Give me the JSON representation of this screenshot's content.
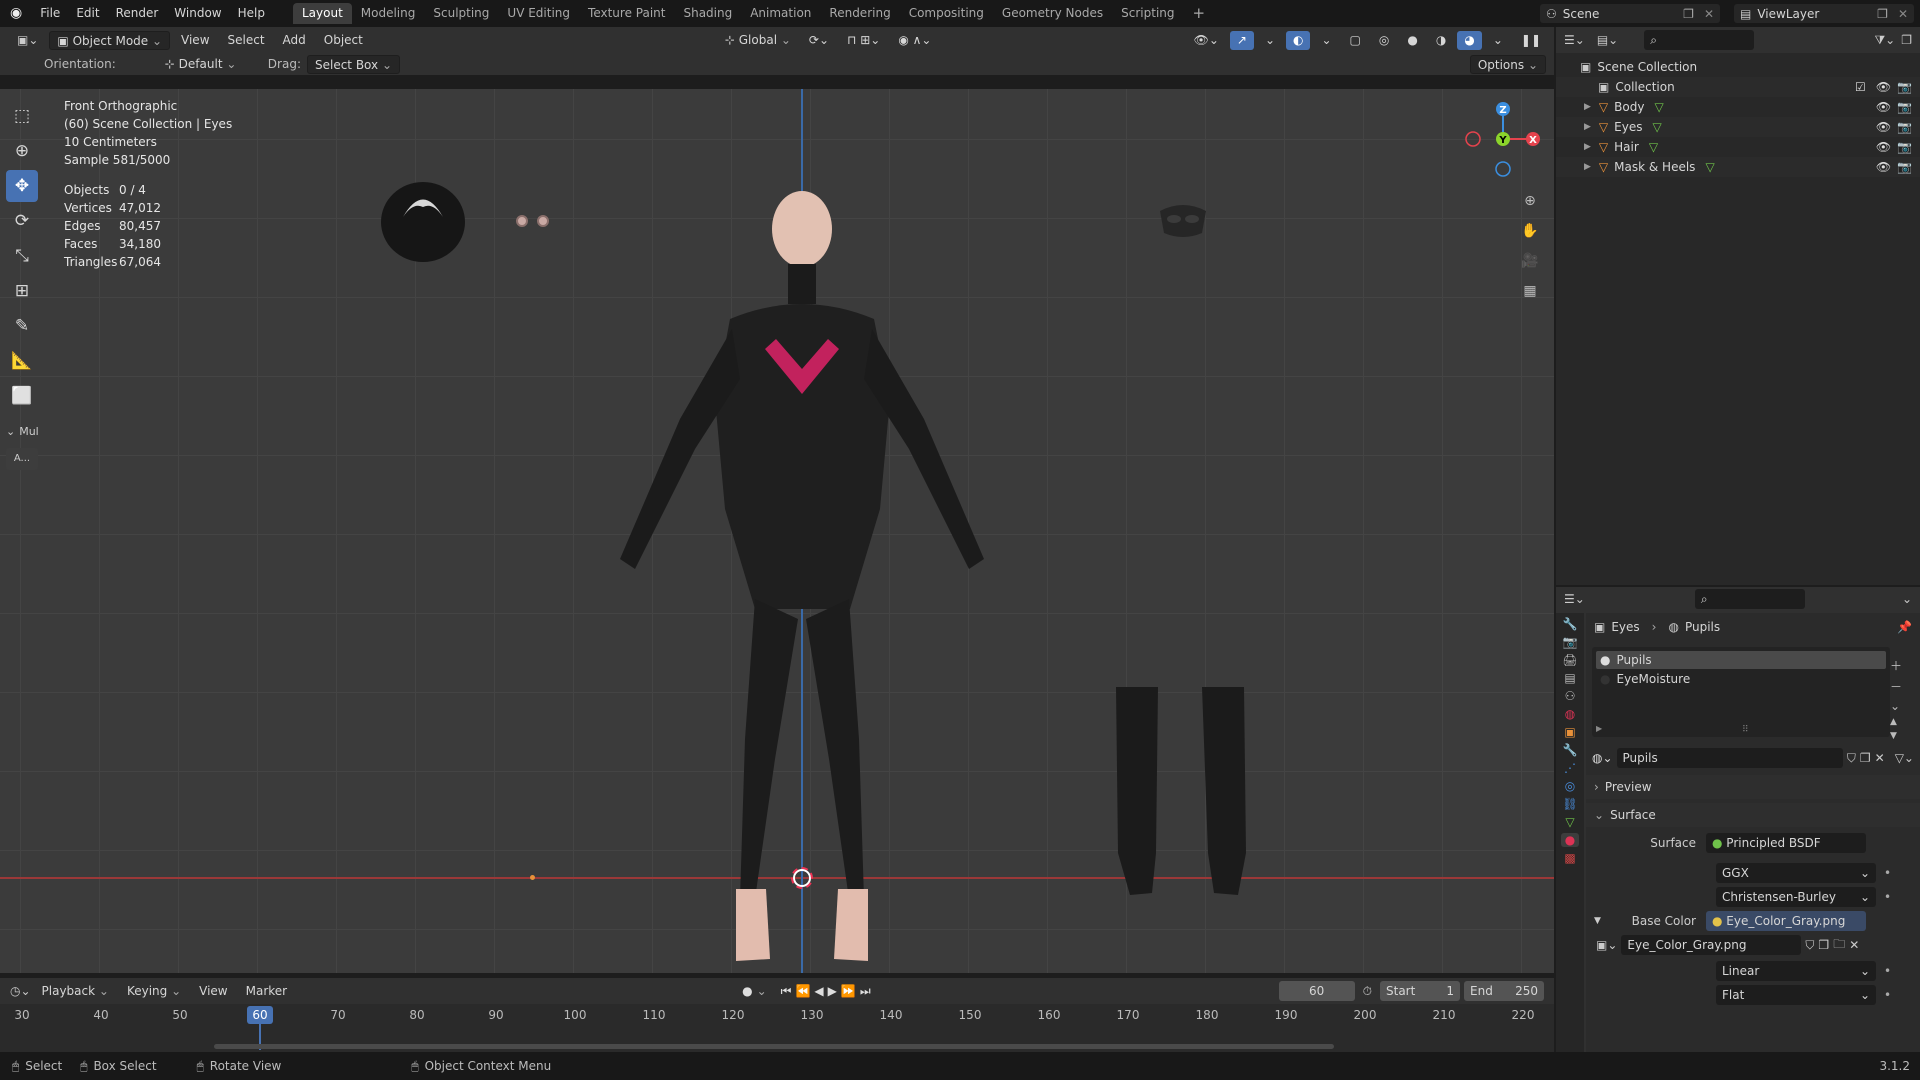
{
  "topbar": {
    "menus": [
      "File",
      "Edit",
      "Render",
      "Window",
      "Help"
    ],
    "workspaces": [
      "Layout",
      "Modeling",
      "Sculpting",
      "UV Editing",
      "Texture Paint",
      "Shading",
      "Animation",
      "Rendering",
      "Compositing",
      "Geometry Nodes",
      "Scripting"
    ],
    "active_workspace": "Layout",
    "add_tab": "+",
    "scene_label": "Scene",
    "viewlayer_label": "ViewLayer"
  },
  "viewport_header": {
    "mode": "Object Mode",
    "menus": [
      "View",
      "Select",
      "Add",
      "Object"
    ],
    "transform": "Global",
    "orientation_label": "Orientation:",
    "orientation_value": "Default",
    "drag_label": "Drag:",
    "drag_value": "Select Box",
    "options": "Options"
  },
  "overlay": {
    "view_name": "Front Orthographic",
    "collection": "(60) Scene Collection | Eyes",
    "scale": "10 Centimeters",
    "sample": "Sample 581/5000",
    "stats": [
      {
        "k": "Objects",
        "v": "0 / 4"
      },
      {
        "k": "Vertices",
        "v": "47,012"
      },
      {
        "k": "Edges",
        "v": "80,457"
      },
      {
        "k": "Faces",
        "v": "34,180"
      },
      {
        "k": "Triangles",
        "v": "67,064"
      }
    ]
  },
  "toolbar": {
    "collapse_label": "Mul",
    "extra_label": "A..."
  },
  "gizmo": {
    "z": "Z",
    "y": "Y",
    "x": "X"
  },
  "outliner": {
    "scene_collection": "Scene Collection",
    "collection": "Collection",
    "items": [
      "Body",
      "Eyes",
      "Hair",
      "Mask & Heels"
    ]
  },
  "properties": {
    "breadcrumb_obj": "Eyes",
    "breadcrumb_mat": "Pupils",
    "slots": [
      "Pupils",
      "EyeMoisture"
    ],
    "material_name": "Pupils",
    "preview": "Preview",
    "surface_section": "Surface",
    "surface_label": "Surface",
    "surface_value": "Principled BSDF",
    "distribution": "GGX",
    "subsurface": "Christensen-Burley",
    "base_color_label": "Base Color",
    "base_color_value": "Eye_Color_Gray.png",
    "image_name": "Eye_Color_Gray.png",
    "interpolation": "Linear",
    "projection": "Flat"
  },
  "timeline": {
    "menus": [
      "Playback",
      "Keying",
      "View",
      "Marker"
    ],
    "current_frame": "60",
    "start_label": "Start",
    "start_value": "1",
    "end_label": "End",
    "end_value": "250",
    "ticks": [
      "30",
      "40",
      "50",
      "60",
      "70",
      "80",
      "90",
      "100",
      "110",
      "120",
      "130",
      "140",
      "150",
      "160",
      "170",
      "180",
      "190",
      "200",
      "210",
      "220"
    ]
  },
  "statusbar": {
    "select": "Select",
    "box_select": "Box Select",
    "rotate_view": "Rotate View",
    "context_menu": "Object Context Menu",
    "version": "3.1.2"
  },
  "colors": {
    "accent": "#4772b3",
    "x_axis": "#e5434d",
    "y_axis": "#8bd42b",
    "z_axis": "#3b8fe0",
    "object_orange": "#e8913a",
    "mesh_green": "#6fc24a"
  }
}
